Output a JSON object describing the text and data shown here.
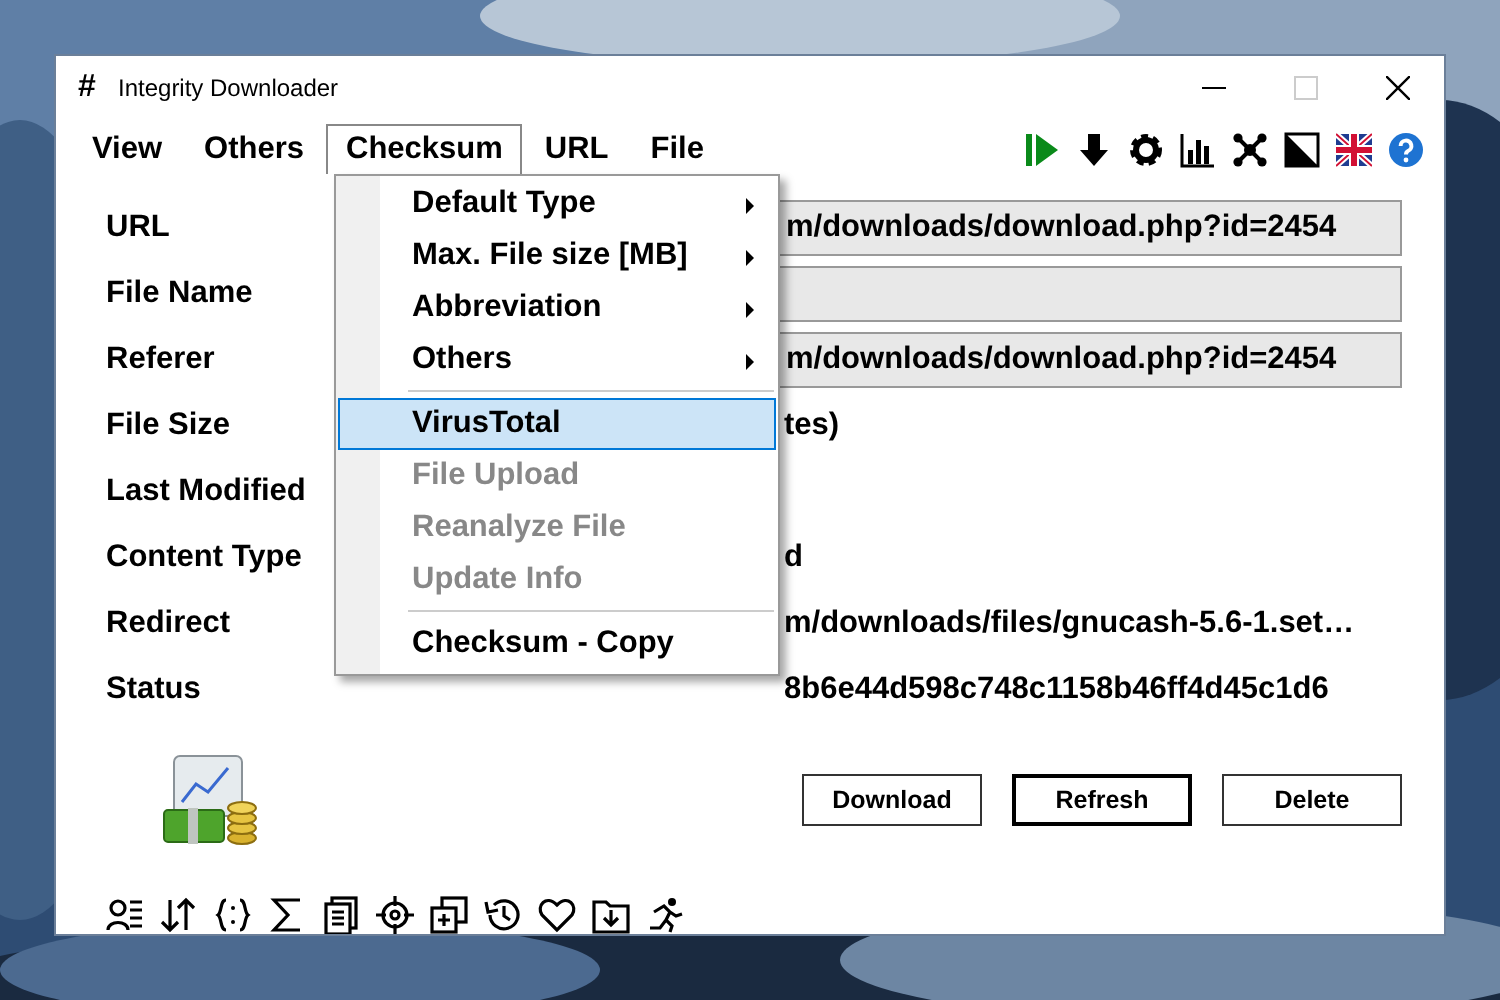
{
  "window": {
    "app_icon": "#",
    "title": "Integrity Downloader"
  },
  "menubar": [
    {
      "label": "View",
      "selected": false
    },
    {
      "label": "Others",
      "selected": false
    },
    {
      "label": "Checksum",
      "selected": true
    },
    {
      "label": "URL",
      "selected": false
    },
    {
      "label": "File",
      "selected": false
    }
  ],
  "fields": [
    {
      "label": "URL",
      "kind": "box",
      "value": "m/downloads/download.php?id=2454"
    },
    {
      "label": "File Name",
      "kind": "box"
    },
    {
      "label": "Referer",
      "kind": "box",
      "value": "m/downloads/download.php?id=2454"
    },
    {
      "label": "File Size",
      "kind": "text",
      "value": "tes)"
    },
    {
      "label": "Last Modified",
      "kind": "text"
    },
    {
      "label": "Content Type",
      "kind": "text",
      "value": "d"
    },
    {
      "label": "Redirect",
      "kind": "text",
      "value": "m/downloads/files/gnucash-5.6-1.set…"
    },
    {
      "label": "Status",
      "kind": "text",
      "value": "8b6e44d598c748c1158b46ff4d45c1d6"
    }
  ],
  "menu": [
    {
      "kind": "item",
      "label": "Default Type",
      "submenu": true,
      "disabled": false,
      "selected": false
    },
    {
      "kind": "item",
      "label": "Max. File size [MB]",
      "submenu": true,
      "disabled": false,
      "selected": false
    },
    {
      "kind": "item",
      "label": "Abbreviation",
      "submenu": true,
      "disabled": false,
      "selected": false
    },
    {
      "kind": "item",
      "label": "Others",
      "submenu": true,
      "disabled": false,
      "selected": false
    },
    {
      "kind": "separator"
    },
    {
      "kind": "item",
      "label": "VirusTotal",
      "submenu": false,
      "disabled": false,
      "selected": true
    },
    {
      "kind": "item",
      "label": "File Upload",
      "submenu": false,
      "disabled": true,
      "selected": false
    },
    {
      "kind": "item",
      "label": "Reanalyze File",
      "submenu": false,
      "disabled": true,
      "selected": false
    },
    {
      "kind": "item",
      "label": "Update Info",
      "submenu": false,
      "disabled": true,
      "selected": false
    },
    {
      "kind": "separator"
    },
    {
      "kind": "item",
      "label": "Checksum - Copy",
      "submenu": false,
      "disabled": false,
      "selected": false
    }
  ],
  "buttons": [
    {
      "label": "Download",
      "default": false
    },
    {
      "label": "Refresh",
      "default": true
    },
    {
      "label": "Delete",
      "default": false
    }
  ]
}
